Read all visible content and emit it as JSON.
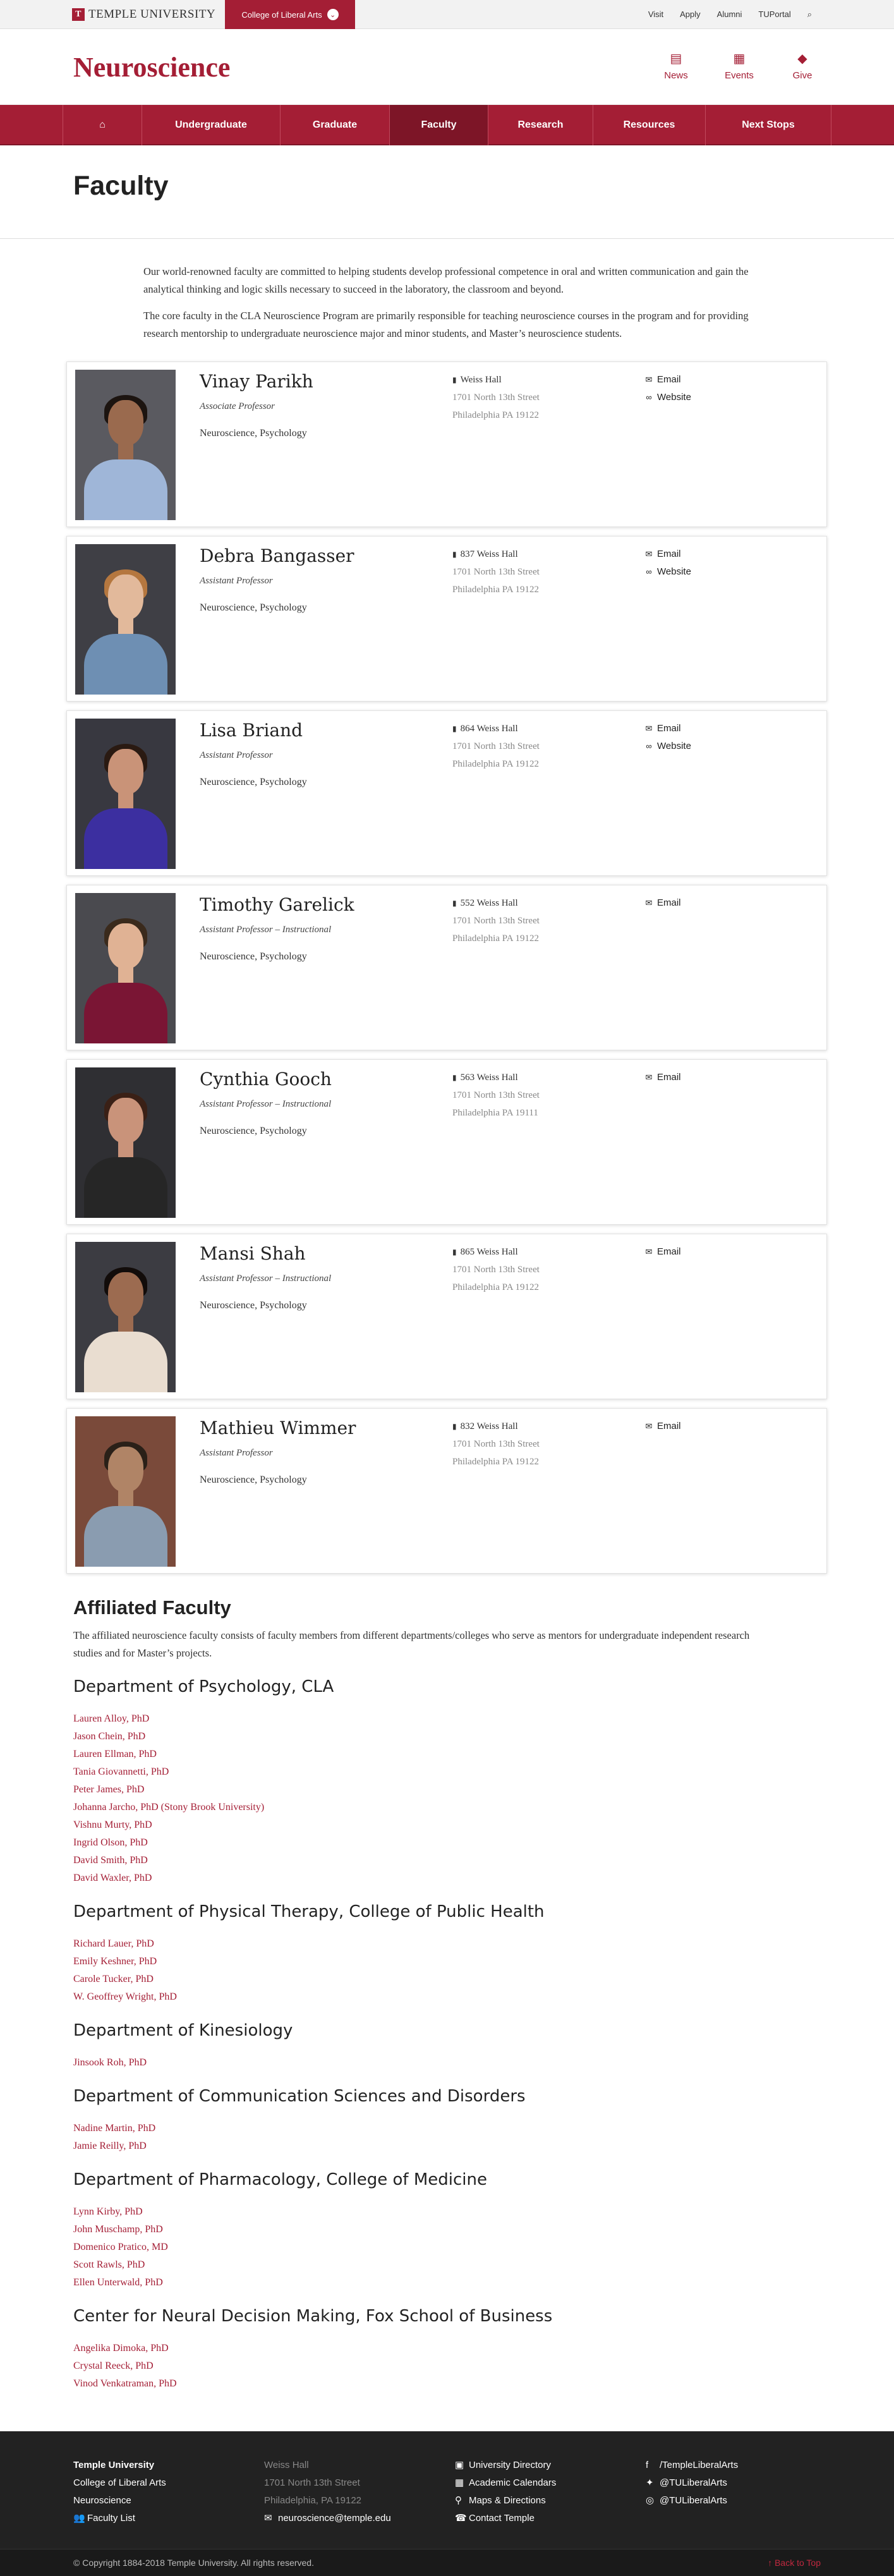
{
  "utility": {
    "university": "TEMPLE UNIVERSITY",
    "college": "College of Liberal Arts",
    "links": [
      "Visit",
      "Apply",
      "Alumni",
      "TUPortal"
    ]
  },
  "header": {
    "site_title": "Neuroscience",
    "icons": [
      {
        "label": "News",
        "icon": "news-icon"
      },
      {
        "label": "Events",
        "icon": "calendar-icon"
      },
      {
        "label": "Give",
        "icon": "graduation-cap-icon"
      }
    ]
  },
  "nav": {
    "items": [
      "Undergraduate",
      "Graduate",
      "Faculty",
      "Research",
      "Resources",
      "Next Stops"
    ],
    "active": "Faculty"
  },
  "page": {
    "title": "Faculty",
    "intro": [
      "Our world-renowned faculty are committed to helping students develop professional competence in oral and written communication and gain the analytical thinking and logic skills necessary to succeed in the laboratory, the classroom and beyond.",
      "The core faculty in the CLA Neuroscience Program are primarily responsible for teaching neuroscience courses in the program and for providing research mentorship to undergraduate neuroscience major and minor students, and Master’s neuroscience students."
    ]
  },
  "faculty": [
    {
      "name": "Vinay Parikh",
      "title": "Associate Professor",
      "dept": "Neuroscience, Psychology",
      "building": "Weiss Hall",
      "street": "1701 North 13th Street",
      "city": "Philadelphia PA 19122",
      "email": "Email",
      "website": "Website"
    },
    {
      "name": "Debra Bangasser",
      "title": "Assistant Professor",
      "dept": "Neuroscience, Psychology",
      "building": "837 Weiss Hall",
      "street": "1701 North 13th Street",
      "city": "Philadelphia PA 19122",
      "email": "Email",
      "website": "Website"
    },
    {
      "name": "Lisa Briand",
      "title": "Assistant Professor",
      "dept": "Neuroscience, Psychology",
      "building": "864 Weiss Hall",
      "street": "1701 North 13th Street",
      "city": "Philadelphia PA 19122",
      "email": "Email",
      "website": "Website"
    },
    {
      "name": "Timothy Garelick",
      "title": "Assistant Professor – Instructional",
      "dept": "Neuroscience, Psychology",
      "building": "552 Weiss Hall",
      "street": "1701 North 13th Street",
      "city": "Philadelphia PA 19122",
      "email": "Email",
      "website": ""
    },
    {
      "name": "Cynthia Gooch",
      "title": "Assistant Professor – Instructional",
      "dept": "Neuroscience, Psychology",
      "building": "563 Weiss Hall",
      "street": "1701 North 13th Street",
      "city": "Philadelphia PA 19111",
      "email": "Email",
      "website": ""
    },
    {
      "name": "Mansi Shah",
      "title": "Assistant Professor – Instructional",
      "dept": "Neuroscience, Psychology",
      "building": "865 Weiss Hall",
      "street": "1701 North 13th Street",
      "city": "Philadelphia PA 19122",
      "email": "Email",
      "website": ""
    },
    {
      "name": "Mathieu Wimmer",
      "title": "Assistant Professor",
      "dept": "Neuroscience, Psychology",
      "building": "832 Weiss Hall",
      "street": "1701 North 13th Street",
      "city": "Philadelphia PA 19122",
      "email": "Email",
      "website": ""
    }
  ],
  "affiliated": {
    "title": "Affiliated Faculty",
    "lead": "The affiliated neuroscience faculty consists of faculty members from different departments/colleges who serve as mentors for undergraduate independent research studies and for Master’s projects.",
    "groups": [
      {
        "name": "Department of Psychology, CLA",
        "members": [
          "Lauren Alloy, PhD",
          "Jason Chein, PhD",
          "Lauren Ellman, PhD",
          "Tania Giovannetti, PhD",
          "Peter James, PhD",
          "Johanna Jarcho, PhD (Stony Brook University)",
          "Vishnu Murty, PhD",
          "Ingrid Olson, PhD",
          "David Smith, PhD",
          "David Waxler, PhD"
        ]
      },
      {
        "name": "Department of Physical Therapy, College of Public Health",
        "members": [
          "Richard Lauer, PhD",
          "Emily Keshner, PhD",
          "Carole Tucker, PhD",
          "W. Geoffrey Wright, PhD"
        ]
      },
      {
        "name": "Department of Kinesiology",
        "members": [
          "Jinsook Roh, PhD"
        ]
      },
      {
        "name": "Department of Communication Sciences and Disorders",
        "members": [
          "Nadine Martin, PhD",
          "Jamie Reilly, PhD"
        ]
      },
      {
        "name": "Department of Pharmacology, College of Medicine",
        "members": [
          "Lynn Kirby, PhD",
          "John Muschamp, PhD",
          "Domenico Pratico, MD",
          "Scott Rawls, PhD",
          "Ellen Unterwald, PhD"
        ]
      },
      {
        "name": "Center for Neural Decision Making, Fox School of Business",
        "members": [
          "Angelika Dimoka, PhD",
          "Crystal Reeck, PhD",
          "Vinod Venkatraman, PhD"
        ]
      }
    ]
  },
  "footer": {
    "col1": {
      "title": "Temple University",
      "lines": [
        "College of Liberal Arts",
        "Neuroscience"
      ],
      "link": "Faculty List"
    },
    "col2": {
      "lines": [
        "Weiss Hall",
        "1701 North 13th Street",
        "Philadelphia, PA 19122"
      ],
      "email": "neuroscience@temple.edu"
    },
    "col3": [
      "University Directory",
      "Academic Calendars",
      "Maps & Directions",
      "Contact Temple"
    ],
    "col4": [
      "/TempleLiberalArts",
      "@TULiberalArts",
      "@TULiberalArts"
    ],
    "copyright": "© Copyright 1884-2018 Temple University. All rights reserved.",
    "back_to_top": "Back to Top"
  },
  "colors": {
    "brand": "#a41e35",
    "footer": "#222222"
  }
}
